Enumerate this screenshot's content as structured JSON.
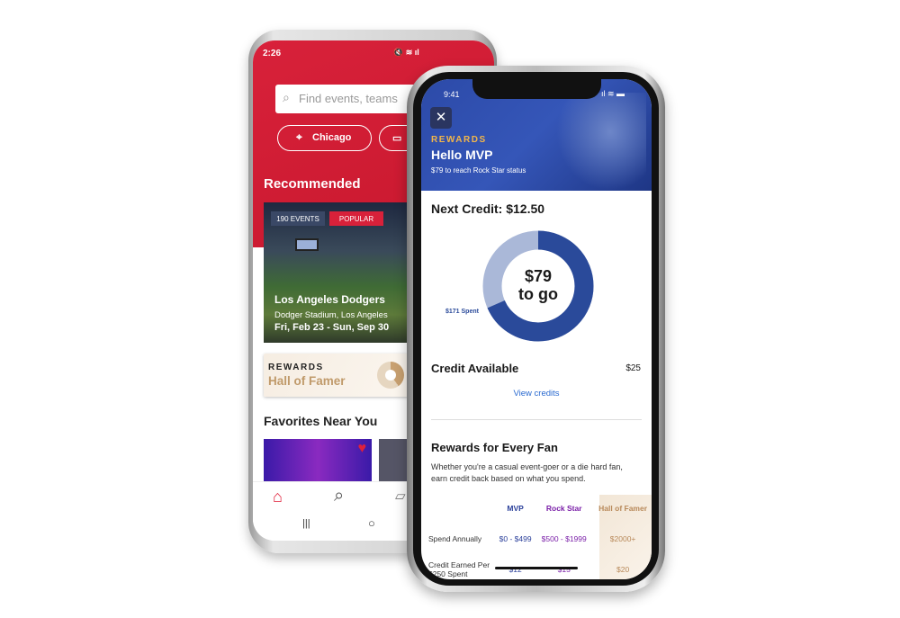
{
  "android": {
    "status_time": "2:26",
    "search_placeholder": "Find events, teams",
    "location_pill": "Chicago",
    "section_recommended": "Recommended",
    "card": {
      "events_badge": "190 EVENTS",
      "popular_badge": "POPULAR",
      "title": "Los Angeles Dodgers",
      "venue": "Dodger Stadium, Los Angeles",
      "dates": "Fri, Feb 23 - Sun, Sep 30"
    },
    "rewards_banner": {
      "label": "REWARDS",
      "tier": "Hall of Famer"
    },
    "section_favorites": "Favorites Near You",
    "nav_icons": [
      "home-icon",
      "search-icon",
      "ticket-icon"
    ],
    "accent": "#d8213a"
  },
  "iphone": {
    "status_time": "9:41",
    "rewards_label": "REWARDS",
    "greeting": "Hello MVP",
    "status_subtitle": "$79 to reach Rock Star status",
    "next_credit": "Next Credit: $12.50",
    "donut": {
      "amount": "$79",
      "caption": "to go",
      "spent_label": "$171 Spent",
      "spent": 171,
      "remaining": 79,
      "spent_color": "#2a4a9a",
      "remaining_color": "#aab8d8"
    },
    "credit_available_label": "Credit Available",
    "credit_available_value": "$25",
    "view_credits": "View credits",
    "rewards_title": "Rewards for Every Fan",
    "rewards_desc": "Whether you're a casual event-goer or a die hard fan, earn credit back based on what you spend.",
    "table": {
      "headers": [
        "MVP",
        "Rock Star",
        "Hall of Famer"
      ],
      "rows": [
        {
          "label": "Spend Annually",
          "values": [
            "$0 - $499",
            "$500 - $1999",
            "$2000+"
          ]
        },
        {
          "label": "Credit Earned Per $250 Spent",
          "values": [
            "$12",
            "$15",
            "$20"
          ]
        }
      ],
      "tier_colors": [
        "#2a3f9a",
        "#7a1fa8",
        "#b8895a"
      ]
    }
  }
}
